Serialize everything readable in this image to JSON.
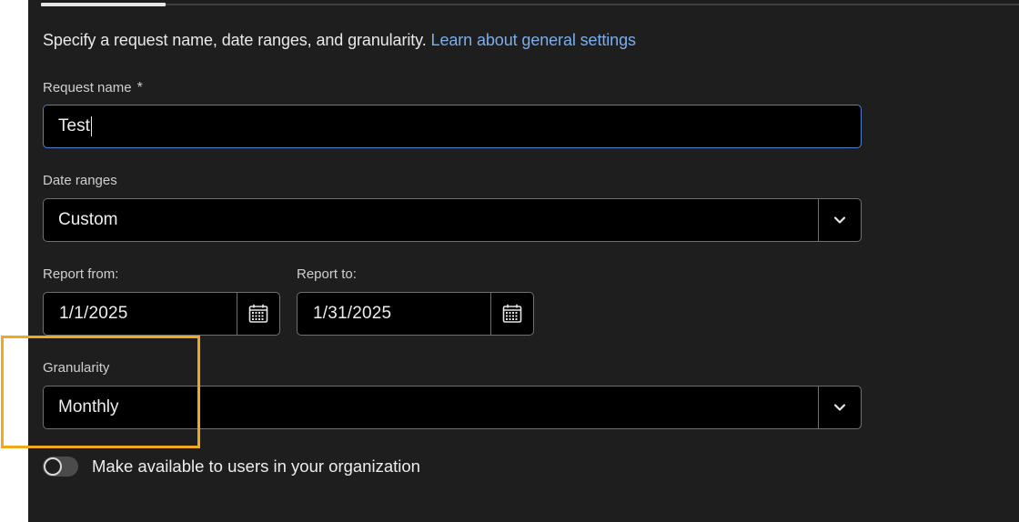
{
  "tabs": {
    "selected_index": 0
  },
  "description": {
    "text": "Specify a request name, date ranges, and granularity.",
    "link_text": "Learn about general settings"
  },
  "request_name": {
    "label": "Request name",
    "required_mark": "*",
    "value": "Test"
  },
  "date_ranges": {
    "label": "Date ranges",
    "selected": "Custom"
  },
  "report_from": {
    "label": "Report from:",
    "value": "1/1/2025"
  },
  "report_to": {
    "label": "Report to:",
    "value": "1/31/2025"
  },
  "granularity": {
    "label": "Granularity",
    "selected": "Monthly"
  },
  "share_toggle": {
    "label": "Make available to users in your organization",
    "checked": false
  },
  "colors": {
    "panel_background": "#1e1e1e",
    "field_background": "#000000",
    "link": "#79aef0",
    "focus_border": "#4f7fd0",
    "highlight": "#f0a81c"
  },
  "icons": {
    "dropdown": "chevron-down-icon",
    "date_picker": "calendar-icon"
  }
}
